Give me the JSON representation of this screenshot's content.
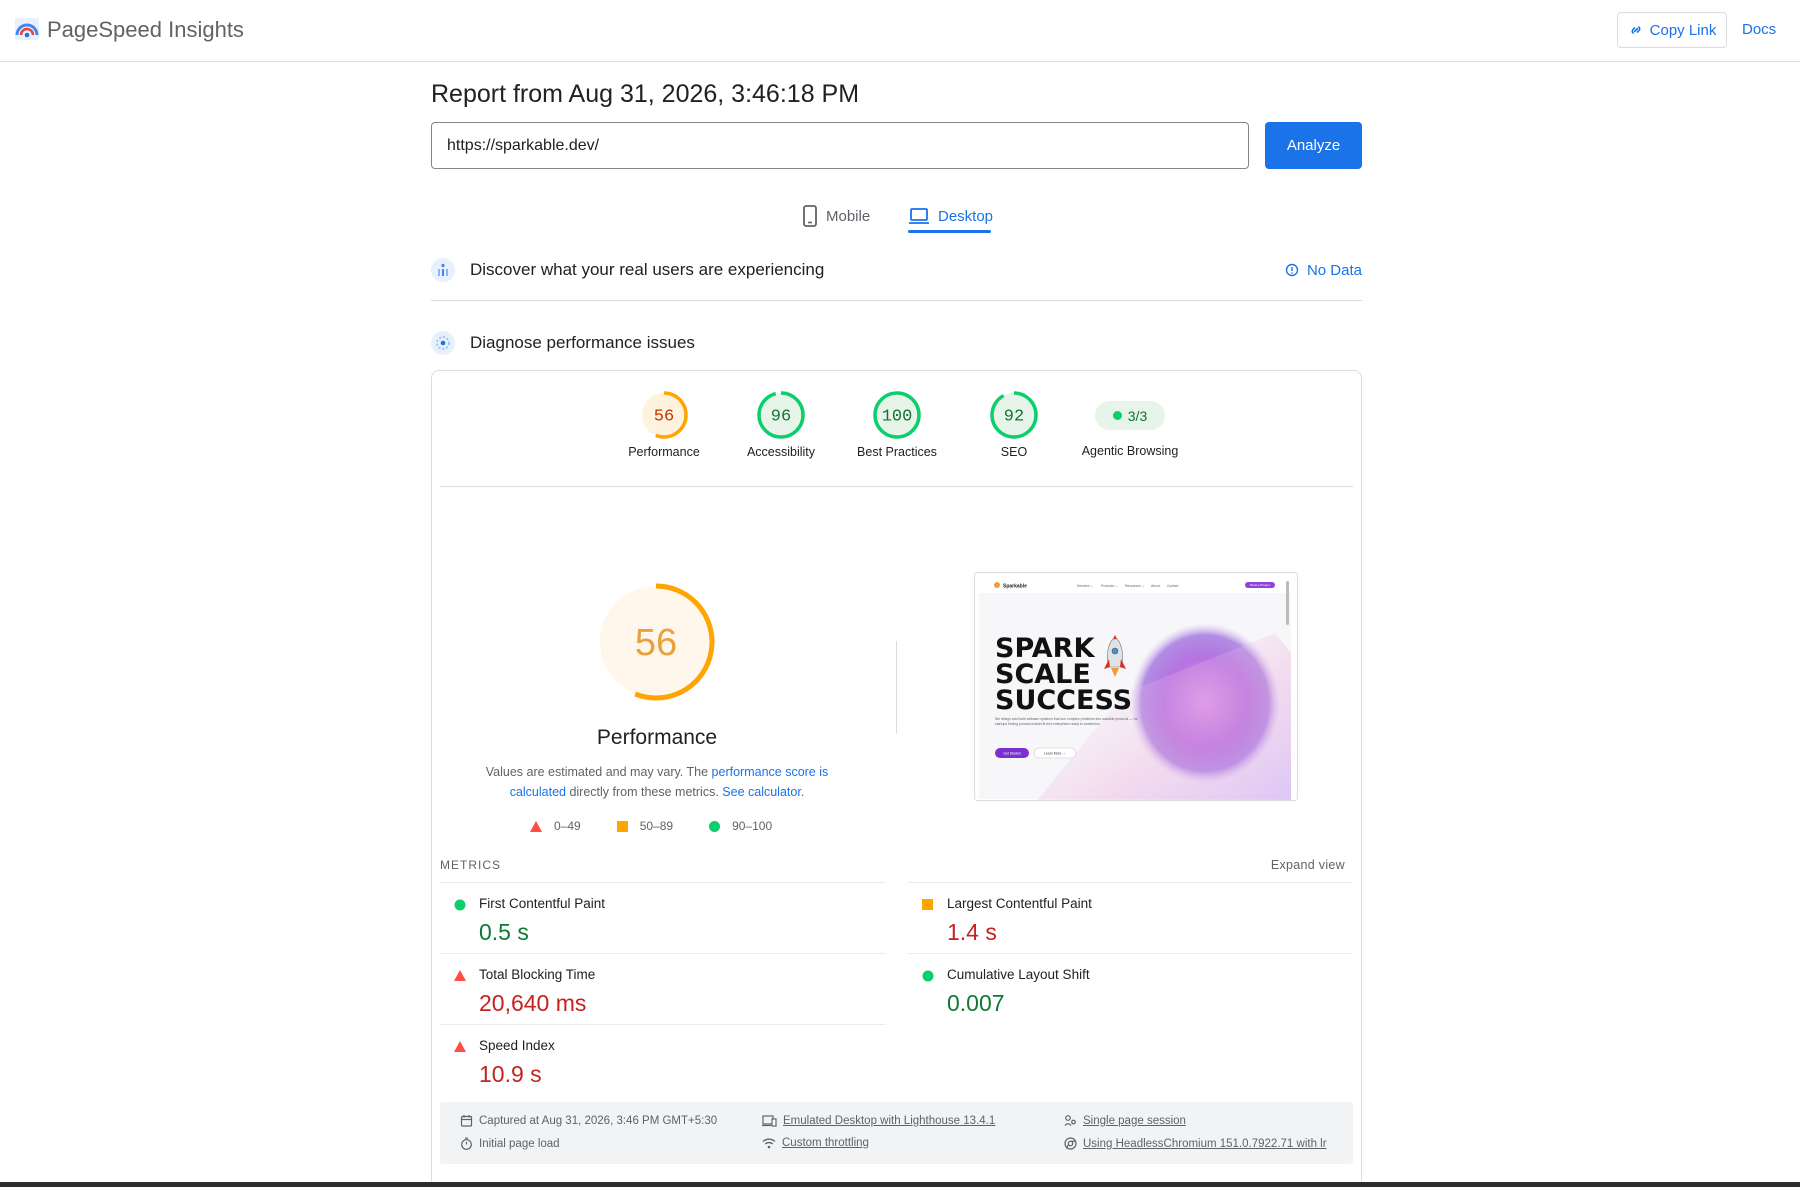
{
  "app": {
    "title": "PageSpeed Insights"
  },
  "header": {
    "copy_link": "Copy Link",
    "docs": "Docs"
  },
  "report": {
    "title": "Report from Aug 31, 2026, 3:46:18 PM",
    "url": "https://sparkable.dev/",
    "analyze_label": "Analyze"
  },
  "tabs": {
    "mobile": "Mobile",
    "desktop": "Desktop",
    "active": "desktop"
  },
  "field": {
    "title": "Discover what your real users are experiencing",
    "status": "No Data"
  },
  "lab": {
    "title": "Diagnose performance issues"
  },
  "categories": [
    {
      "label": "Performance",
      "score": "56",
      "value": 56,
      "status": "average"
    },
    {
      "label": "Accessibility",
      "score": "96",
      "value": 96,
      "status": "pass"
    },
    {
      "label": "Best Practices",
      "score": "100",
      "value": 100,
      "status": "pass"
    },
    {
      "label": "SEO",
      "score": "92",
      "value": 92,
      "status": "pass"
    },
    {
      "label": "Agentic Browsing",
      "score": "3/3",
      "status": "pass"
    }
  ],
  "performance": {
    "score": "56",
    "value": 56,
    "title": "Performance",
    "note_prefix": "Values are estimated and may vary. The ",
    "note_link1": "performance score is calculated",
    "note_mid": " directly from these metrics. ",
    "note_link2": "See calculator",
    "note_suffix": ".",
    "legend": [
      "0–49",
      "50–89",
      "90–100"
    ]
  },
  "screenshot": {
    "brand": "Sparkable",
    "nav": [
      "Services ⌄",
      "Products ⌄",
      "Resources ⌄",
      "About",
      "Contact"
    ],
    "cta": "Book a Project",
    "headline": [
      "SPARK",
      "SCALE",
      "SUCCESS"
    ],
    "body": "We design and build software systems that turn complex problems into scalable products — for startups finding product-market fit and enterprises ready to modernize.",
    "btn_primary": "Get Started",
    "btn_secondary": "Learn More →"
  },
  "metrics": {
    "label": "METRICS",
    "expand": "Expand view",
    "items": [
      {
        "name": "First Contentful Paint",
        "value": "0.5 s",
        "status": "pass"
      },
      {
        "name": "Largest Contentful Paint",
        "value": "1.4 s",
        "status": "average"
      },
      {
        "name": "Total Blocking Time",
        "value": "20,640 ms",
        "status": "fail"
      },
      {
        "name": "Cumulative Layout Shift",
        "value": "0.007",
        "status": "pass"
      },
      {
        "name": "Speed Index",
        "value": "10.9 s",
        "status": "fail"
      }
    ]
  },
  "runtime": {
    "captured": "Captured at Aug 31, 2026, 3:46 PM GMT+5:30",
    "initial_load": "Initial page load",
    "emulated": "Emulated Desktop with Lighthouse 13.4.1",
    "throttling": "Custom throttling",
    "session": "Single page session",
    "browser": "Using HeadlessChromium 151.0.7922.71 with lr"
  },
  "colors": {
    "accent": "#1a73e8",
    "pass": "#0cce6b",
    "average": "#ffa400",
    "fail": "#ff4e42"
  }
}
